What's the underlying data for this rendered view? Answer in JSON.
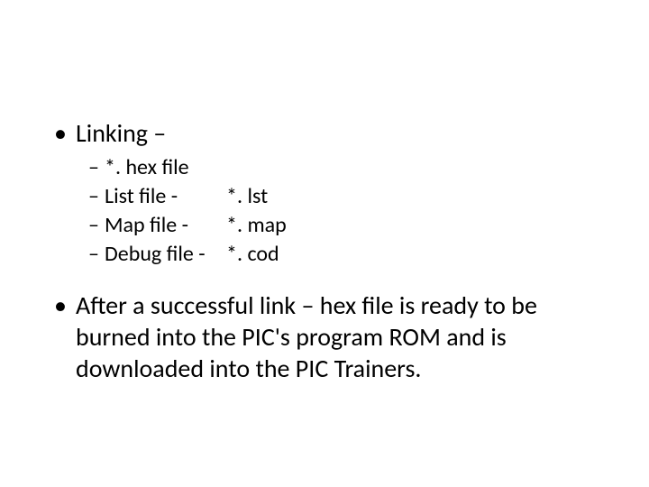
{
  "slide": {
    "bullet1": {
      "title": "Linking –",
      "items": [
        {
          "label": "*. hex file",
          "ext": ""
        },
        {
          "label": "List file -",
          "ext": "*. lst"
        },
        {
          "label": "Map file -",
          "ext": "*. map"
        },
        {
          "label": "Debug file -",
          "ext": "*. cod"
        }
      ]
    },
    "bullet2": "After a successful link – hex file is ready to be burned into the PIC's program ROM and is downloaded into the PIC Trainers."
  }
}
